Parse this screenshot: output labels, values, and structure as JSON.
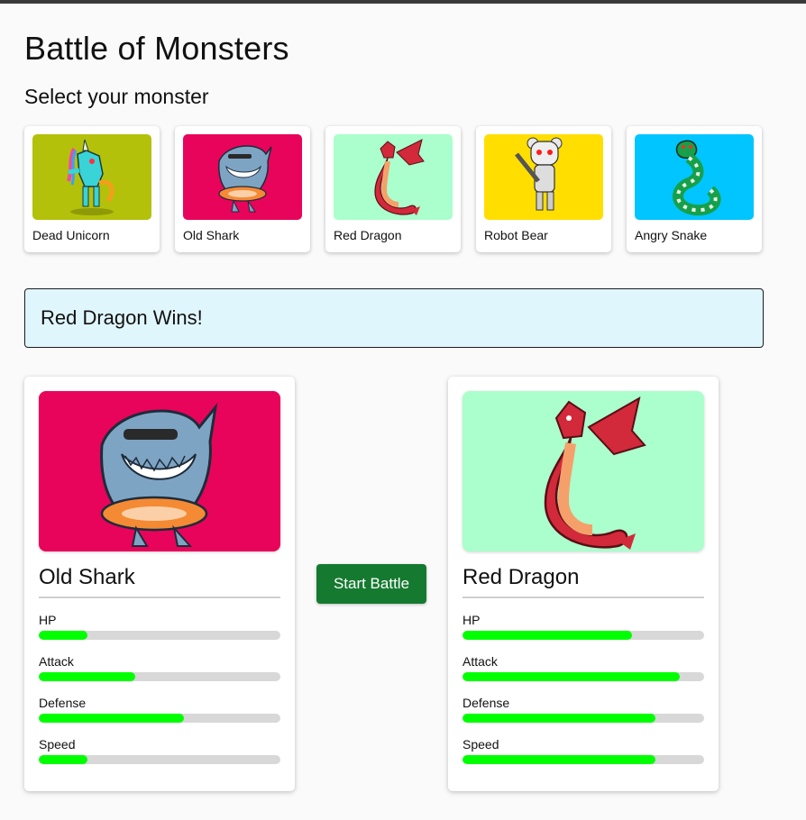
{
  "app": {
    "title": "Battle of Monsters",
    "subtitle": "Select your monster",
    "winner_text": "Red Dragon Wins!",
    "start_button": "Start Battle"
  },
  "monsters": [
    {
      "name": "Dead Unicorn",
      "bg": "#b3c10a",
      "icon": "unicorn-icon"
    },
    {
      "name": "Old Shark",
      "bg": "#e8045a",
      "icon": "shark-icon"
    },
    {
      "name": "Red Dragon",
      "bg": "#aaffcc",
      "icon": "dragon-icon"
    },
    {
      "name": "Robot Bear",
      "bg": "#ffde00",
      "icon": "robot-bear-icon"
    },
    {
      "name": "Angry Snake",
      "bg": "#00c5ff",
      "icon": "snake-icon"
    }
  ],
  "player": {
    "name": "Old Shark",
    "bg": "#e8045a",
    "stats": [
      {
        "label": "HP",
        "value": 0.2
      },
      {
        "label": "Attack",
        "value": 0.4
      },
      {
        "label": "Defense",
        "value": 0.6
      },
      {
        "label": "Speed",
        "value": 0.2
      }
    ]
  },
  "computer": {
    "name": "Red Dragon",
    "bg": "#aaffcc",
    "stats": [
      {
        "label": "HP",
        "value": 0.7
      },
      {
        "label": "Attack",
        "value": 0.9
      },
      {
        "label": "Defense",
        "value": 0.8
      },
      {
        "label": "Speed",
        "value": 0.8
      }
    ]
  },
  "colors": {
    "stat_fill": "#00ff00",
    "stat_track": "#d8d8d8",
    "button": "#157a30",
    "winner_bg": "#e0f6fd"
  }
}
